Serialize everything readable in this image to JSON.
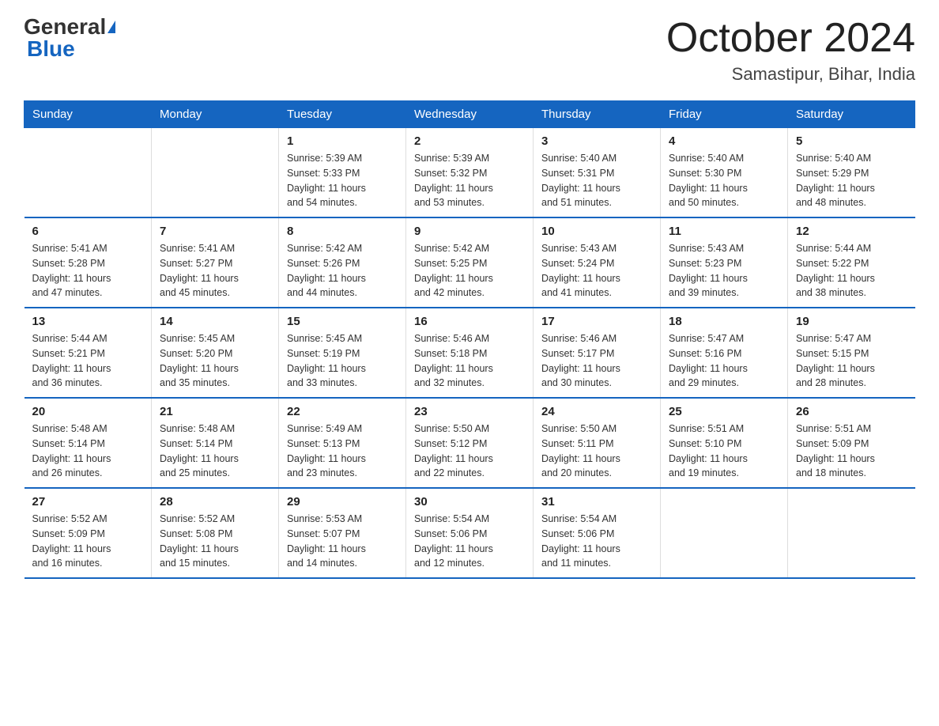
{
  "logo": {
    "general": "General",
    "blue": "Blue"
  },
  "title": "October 2024",
  "location": "Samastipur, Bihar, India",
  "headers": [
    "Sunday",
    "Monday",
    "Tuesday",
    "Wednesday",
    "Thursday",
    "Friday",
    "Saturday"
  ],
  "weeks": [
    [
      {
        "day": "",
        "info": ""
      },
      {
        "day": "",
        "info": ""
      },
      {
        "day": "1",
        "info": "Sunrise: 5:39 AM\nSunset: 5:33 PM\nDaylight: 11 hours\nand 54 minutes."
      },
      {
        "day": "2",
        "info": "Sunrise: 5:39 AM\nSunset: 5:32 PM\nDaylight: 11 hours\nand 53 minutes."
      },
      {
        "day": "3",
        "info": "Sunrise: 5:40 AM\nSunset: 5:31 PM\nDaylight: 11 hours\nand 51 minutes."
      },
      {
        "day": "4",
        "info": "Sunrise: 5:40 AM\nSunset: 5:30 PM\nDaylight: 11 hours\nand 50 minutes."
      },
      {
        "day": "5",
        "info": "Sunrise: 5:40 AM\nSunset: 5:29 PM\nDaylight: 11 hours\nand 48 minutes."
      }
    ],
    [
      {
        "day": "6",
        "info": "Sunrise: 5:41 AM\nSunset: 5:28 PM\nDaylight: 11 hours\nand 47 minutes."
      },
      {
        "day": "7",
        "info": "Sunrise: 5:41 AM\nSunset: 5:27 PM\nDaylight: 11 hours\nand 45 minutes."
      },
      {
        "day": "8",
        "info": "Sunrise: 5:42 AM\nSunset: 5:26 PM\nDaylight: 11 hours\nand 44 minutes."
      },
      {
        "day": "9",
        "info": "Sunrise: 5:42 AM\nSunset: 5:25 PM\nDaylight: 11 hours\nand 42 minutes."
      },
      {
        "day": "10",
        "info": "Sunrise: 5:43 AM\nSunset: 5:24 PM\nDaylight: 11 hours\nand 41 minutes."
      },
      {
        "day": "11",
        "info": "Sunrise: 5:43 AM\nSunset: 5:23 PM\nDaylight: 11 hours\nand 39 minutes."
      },
      {
        "day": "12",
        "info": "Sunrise: 5:44 AM\nSunset: 5:22 PM\nDaylight: 11 hours\nand 38 minutes."
      }
    ],
    [
      {
        "day": "13",
        "info": "Sunrise: 5:44 AM\nSunset: 5:21 PM\nDaylight: 11 hours\nand 36 minutes."
      },
      {
        "day": "14",
        "info": "Sunrise: 5:45 AM\nSunset: 5:20 PM\nDaylight: 11 hours\nand 35 minutes."
      },
      {
        "day": "15",
        "info": "Sunrise: 5:45 AM\nSunset: 5:19 PM\nDaylight: 11 hours\nand 33 minutes."
      },
      {
        "day": "16",
        "info": "Sunrise: 5:46 AM\nSunset: 5:18 PM\nDaylight: 11 hours\nand 32 minutes."
      },
      {
        "day": "17",
        "info": "Sunrise: 5:46 AM\nSunset: 5:17 PM\nDaylight: 11 hours\nand 30 minutes."
      },
      {
        "day": "18",
        "info": "Sunrise: 5:47 AM\nSunset: 5:16 PM\nDaylight: 11 hours\nand 29 minutes."
      },
      {
        "day": "19",
        "info": "Sunrise: 5:47 AM\nSunset: 5:15 PM\nDaylight: 11 hours\nand 28 minutes."
      }
    ],
    [
      {
        "day": "20",
        "info": "Sunrise: 5:48 AM\nSunset: 5:14 PM\nDaylight: 11 hours\nand 26 minutes."
      },
      {
        "day": "21",
        "info": "Sunrise: 5:48 AM\nSunset: 5:14 PM\nDaylight: 11 hours\nand 25 minutes."
      },
      {
        "day": "22",
        "info": "Sunrise: 5:49 AM\nSunset: 5:13 PM\nDaylight: 11 hours\nand 23 minutes."
      },
      {
        "day": "23",
        "info": "Sunrise: 5:50 AM\nSunset: 5:12 PM\nDaylight: 11 hours\nand 22 minutes."
      },
      {
        "day": "24",
        "info": "Sunrise: 5:50 AM\nSunset: 5:11 PM\nDaylight: 11 hours\nand 20 minutes."
      },
      {
        "day": "25",
        "info": "Sunrise: 5:51 AM\nSunset: 5:10 PM\nDaylight: 11 hours\nand 19 minutes."
      },
      {
        "day": "26",
        "info": "Sunrise: 5:51 AM\nSunset: 5:09 PM\nDaylight: 11 hours\nand 18 minutes."
      }
    ],
    [
      {
        "day": "27",
        "info": "Sunrise: 5:52 AM\nSunset: 5:09 PM\nDaylight: 11 hours\nand 16 minutes."
      },
      {
        "day": "28",
        "info": "Sunrise: 5:52 AM\nSunset: 5:08 PM\nDaylight: 11 hours\nand 15 minutes."
      },
      {
        "day": "29",
        "info": "Sunrise: 5:53 AM\nSunset: 5:07 PM\nDaylight: 11 hours\nand 14 minutes."
      },
      {
        "day": "30",
        "info": "Sunrise: 5:54 AM\nSunset: 5:06 PM\nDaylight: 11 hours\nand 12 minutes."
      },
      {
        "day": "31",
        "info": "Sunrise: 5:54 AM\nSunset: 5:06 PM\nDaylight: 11 hours\nand 11 minutes."
      },
      {
        "day": "",
        "info": ""
      },
      {
        "day": "",
        "info": ""
      }
    ]
  ]
}
